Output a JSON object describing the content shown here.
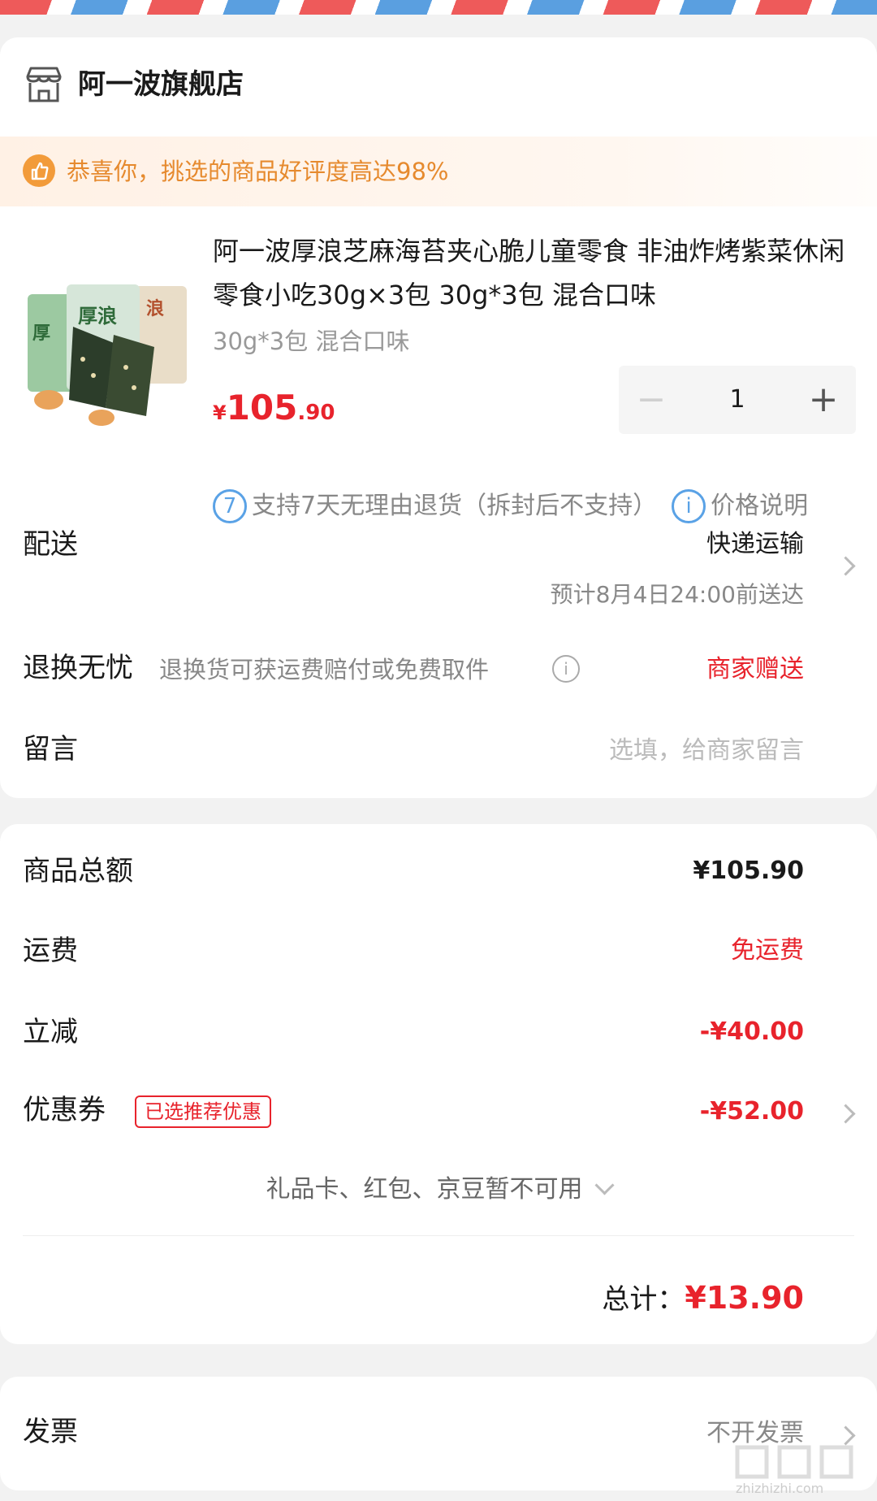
{
  "shop": {
    "name": "阿一波旗舰店",
    "icon": "store-icon"
  },
  "banner": {
    "text": "恭喜你，挑选的商品好评度高达98%",
    "icon": "thumbs-up-icon",
    "accent": "#f29b3a"
  },
  "product": {
    "title": "阿一波厚浪芝麻海苔夹心脆儿童零食 非油炸烤紫菜休闲零食小吃30g×3包 30g*3包 混合口味",
    "spec": "30g*3包 混合口味",
    "price": {
      "currency": "¥",
      "integer": "105",
      "decimal": ".90"
    },
    "quantity": "1",
    "image_label_1": "厚",
    "image_label_2": "厚浪",
    "image_label_3": "浪",
    "service": {
      "badge": "7",
      "text": "支持7天无理由退货（拆封后不支持）",
      "info_badge": "i",
      "note": "价格说明"
    }
  },
  "delivery": {
    "label": "配送",
    "method": "快递运输",
    "eta": "预计8月4日24:00前送达"
  },
  "return_worry": {
    "label": "退换无忧",
    "desc": "退换货可获运费赔付或免费取件",
    "info": "i",
    "value": "商家赠送"
  },
  "message": {
    "label": "留言",
    "placeholder": "选填，给商家留言"
  },
  "summary": {
    "goods_total": {
      "label": "商品总额",
      "value": "¥105.90"
    },
    "shipping": {
      "label": "运费",
      "value": "免运费"
    },
    "discount": {
      "label": "立减",
      "value": "-¥40.00"
    },
    "coupon": {
      "label": "优惠券",
      "tag": "已选推荐优惠",
      "value": "-¥52.00"
    },
    "unavailable": "礼品卡、红包、京豆暂不可用",
    "total_label": "总计：",
    "total_value": "¥13.90"
  },
  "invoice": {
    "label": "发票",
    "value": "不开发票"
  },
  "watermark": "zhizhizhi.com",
  "colors": {
    "accent_red": "#e8232c",
    "banner_orange": "#e68a2e",
    "info_blue": "#5aa2e6"
  }
}
